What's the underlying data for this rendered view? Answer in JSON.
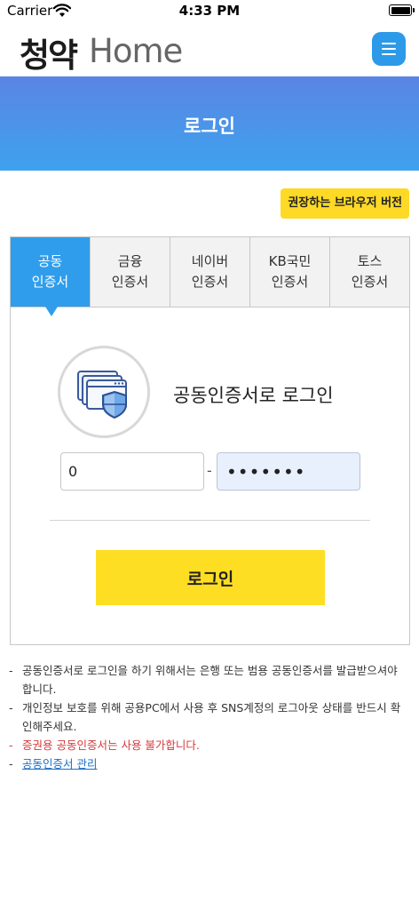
{
  "status_bar": {
    "carrier": "Carrier",
    "time": "4:33 PM"
  },
  "header": {
    "logo_korean": "청약",
    "logo_english": "Home",
    "menu_icon": "hamburger-icon",
    "accent_color": "#2c9ae8"
  },
  "banner": {
    "title": "로그인",
    "gradient": [
      "#5a85e4",
      "#3ea2ee"
    ]
  },
  "browser_button": {
    "label": "권장하는 브라우저 버전",
    "color": "#fed926"
  },
  "tabs": [
    {
      "line1": "공동",
      "line2": "인증서",
      "active": true
    },
    {
      "line1": "금융",
      "line2": "인증서",
      "active": false
    },
    {
      "line1": "네이버",
      "line2": "인증서",
      "active": false
    },
    {
      "line1": "KB국민",
      "line2": "인증서",
      "active": false
    },
    {
      "line1": "토스",
      "line2": "인증서",
      "active": false
    }
  ],
  "cert_login": {
    "title": "공동인증서로 로그인",
    "icon": "certificate-shield-icon",
    "id_value": "0",
    "separator": "-",
    "password_masked": "•••••••",
    "login_label": "로그인",
    "login_color": "#fede23"
  },
  "notes": [
    {
      "text": "공동인증서로 로그인을 하기 위해서는 은행 또는 범용 공동인증서를 발급받으셔야 합니다.",
      "type": "normal"
    },
    {
      "text": "개인정보 보호를 위해 공용PC에서 사용 후 SNS계정의 로그아웃 상태를 반드시 확인해주세요.",
      "type": "normal"
    },
    {
      "text": "증권용 공동인증서는 사용 불가합니다.",
      "type": "warn",
      "color": "#d33a3a"
    },
    {
      "text": "공동인증서 관리",
      "type": "link",
      "color": "#1a6fc4"
    }
  ]
}
